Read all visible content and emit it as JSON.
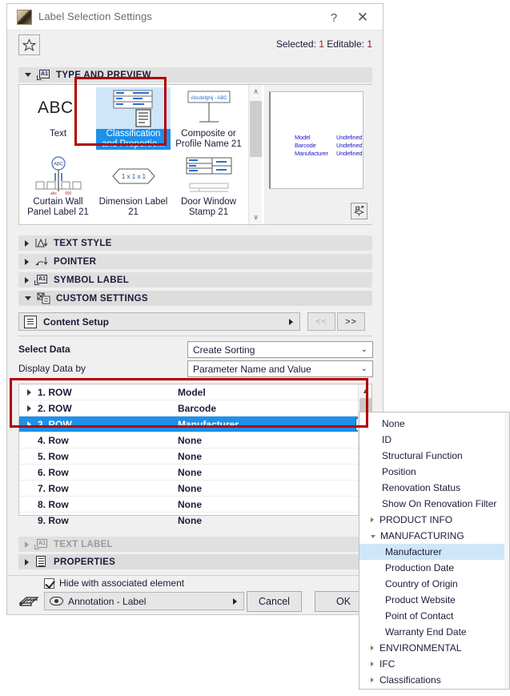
{
  "window": {
    "title": "Label Selection Settings",
    "help_label": "?",
    "close_label": "✕",
    "favorite_icon": "star-icon",
    "selection_status_prefix": "Selected: ",
    "selection_status_count": "1",
    "editable_prefix": " Editable: ",
    "editable_count": "1"
  },
  "sections": [
    {
      "key": "type_and_preview",
      "title": "TYPE AND PREVIEW",
      "expanded": true,
      "icon": "a1-label-icon",
      "disabled": false
    },
    {
      "key": "text_style",
      "title": "TEXT STYLE",
      "expanded": false,
      "icon": "text-style-icon",
      "disabled": false
    },
    {
      "key": "pointer",
      "title": "POINTER",
      "expanded": false,
      "icon": "pointer-icon",
      "disabled": false
    },
    {
      "key": "symbol_label",
      "title": "SYMBOL LABEL",
      "expanded": false,
      "icon": "a1-label-icon",
      "disabled": false
    },
    {
      "key": "custom_settings",
      "title": "CUSTOM SETTINGS",
      "expanded": true,
      "icon": "custom-settings-icon",
      "disabled": false
    },
    {
      "key": "text_label",
      "title": "TEXT LABEL",
      "expanded": false,
      "icon": "a1-label-icon",
      "disabled": true
    },
    {
      "key": "properties",
      "title": "PROPERTIES",
      "expanded": false,
      "icon": "properties-icon",
      "disabled": false
    }
  ],
  "type_grid": {
    "tiles": [
      {
        "label": "Text",
        "art": "ABCI",
        "selected": false
      },
      {
        "label": "Classification and Propertie...",
        "art": "table-doc",
        "selected": true
      },
      {
        "label": "Composite or Profile Name 21",
        "art": "Abcdefghij - ABC",
        "selected": false
      },
      {
        "label": "Curtain Wall Panel Label 21",
        "art": "ABC",
        "selected": false
      },
      {
        "label": "Dimension Label 21",
        "art": "1 x 1 x 1",
        "selected": false
      },
      {
        "label": "Door Window Stamp 21",
        "art": "door-window",
        "selected": false
      }
    ],
    "scroll_up": "∧",
    "scroll_down": "∨"
  },
  "preview": {
    "rows": [
      {
        "name": "Model",
        "value": "Undefined"
      },
      {
        "name": "Barcode",
        "value": "Undefined"
      },
      {
        "name": "Manufacturer",
        "value": "Undefined"
      }
    ],
    "view_button_icon": "3d-view-icon",
    "text_color": "#2020cc"
  },
  "custom_settings": {
    "content_setup_label": "Content Setup",
    "content_setup_icon": "list-icon",
    "prev_label": "<<",
    "next_label": ">>"
  },
  "fields": {
    "select_data_label": "Select Data",
    "select_data_value": "Create Sorting",
    "display_data_by_label": "Display Data by",
    "display_data_by_value": "Parameter Name and Value"
  },
  "rows_list": [
    {
      "index": "1. ROW",
      "value": "Model",
      "selected": false,
      "expandable": true
    },
    {
      "index": "2. ROW",
      "value": "Barcode",
      "selected": false,
      "expandable": true
    },
    {
      "index": "3. ROW",
      "value": "Manufacturer",
      "selected": true,
      "expandable": true
    },
    {
      "index": "4. Row",
      "value": "None",
      "selected": false,
      "expandable": false
    },
    {
      "index": "5. Row",
      "value": "None",
      "selected": false,
      "expandable": false
    },
    {
      "index": "6. Row",
      "value": "None",
      "selected": false,
      "expandable": false
    },
    {
      "index": "7. Row",
      "value": "None",
      "selected": false,
      "expandable": false
    },
    {
      "index": "8. Row",
      "value": "None",
      "selected": false,
      "expandable": false
    },
    {
      "index": "9. Row",
      "value": "None",
      "selected": false,
      "expandable": false
    }
  ],
  "footer": {
    "checkbox_label": "Hide with associated element",
    "checkbox_checked": true,
    "layer_value": "Annotation - Label",
    "layer_icon": "eye-icon",
    "pen_icon": "pen-set-icon",
    "cancel_label": "Cancel",
    "ok_label": "OK"
  },
  "menu": {
    "items": [
      {
        "label": "None",
        "type": "item",
        "highlighted": false
      },
      {
        "label": "ID",
        "type": "item",
        "highlighted": false
      },
      {
        "label": "Structural Function",
        "type": "item",
        "highlighted": false
      },
      {
        "label": "Position",
        "type": "item",
        "highlighted": false
      },
      {
        "label": "Renovation Status",
        "type": "item",
        "highlighted": false
      },
      {
        "label": "Show On Renovation Filter",
        "type": "item",
        "highlighted": false
      },
      {
        "label": "PRODUCT INFO",
        "type": "group-collapsed",
        "highlighted": false
      },
      {
        "label": "MANUFACTURING",
        "type": "group-expanded",
        "highlighted": false
      },
      {
        "label": "Manufacturer",
        "type": "sub",
        "highlighted": true
      },
      {
        "label": "Production Date",
        "type": "sub",
        "highlighted": false
      },
      {
        "label": "Country of Origin",
        "type": "sub",
        "highlighted": false
      },
      {
        "label": "Product Website",
        "type": "sub",
        "highlighted": false
      },
      {
        "label": "Point of Contact",
        "type": "sub",
        "highlighted": false
      },
      {
        "label": "Warranty End Date",
        "type": "sub",
        "highlighted": false
      },
      {
        "label": "ENVIRONMENTAL",
        "type": "group-collapsed",
        "highlighted": false
      },
      {
        "label": "IFC",
        "type": "group-collapsed",
        "highlighted": false
      },
      {
        "label": "Classifications",
        "type": "group-collapsed",
        "highlighted": false
      }
    ]
  },
  "annotations": {
    "highlight_color": "#b00000",
    "selection_color": "#1e90e8",
    "highlight_regions": [
      "classification-tile",
      "selected-row-band"
    ]
  }
}
